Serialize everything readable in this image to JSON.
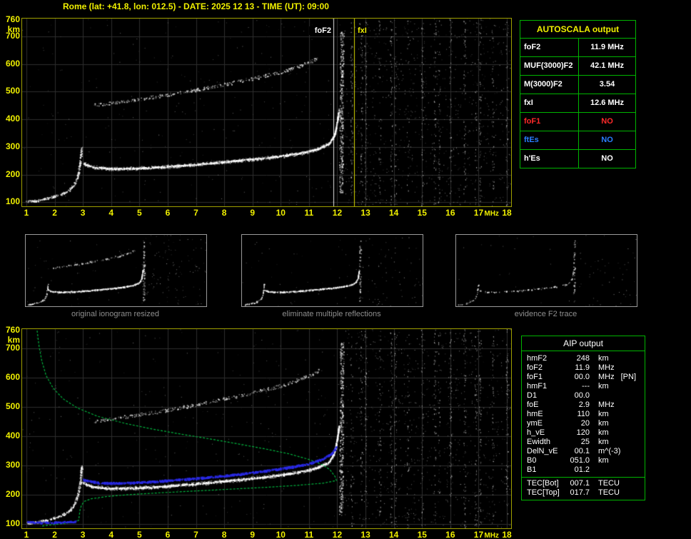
{
  "title": "Rome (lat: +41.8, lon: 012.5) - DATE: 2025 12 13 - TIME (UT): 09:00",
  "colors": {
    "accent": "#f0f000",
    "plot_border": "#a0a000",
    "table_border": "#00b400",
    "trace": "#ffffff",
    "profile": "#00b33c",
    "restored": "#2a2ae6",
    "caption": "#8f8f8f",
    "no_red": "#ff2a2a",
    "no_blue": "#2a7fff",
    "grid": "#2d2d2d"
  },
  "autoscala": {
    "header": "AUTOSCALA output",
    "rows": [
      {
        "label": "foF2",
        "value": "11.9 MHz",
        "color": "#ffffff"
      },
      {
        "label": "MUF(3000)F2",
        "value": "42.1 MHz",
        "color": "#ffffff"
      },
      {
        "label": "M(3000)F2",
        "value": "3.54",
        "color": "#ffffff"
      },
      {
        "label": "fxI",
        "value": "12.6 MHz",
        "color": "#ffffff"
      },
      {
        "label": "foF1",
        "value": "NO",
        "color": "#ff2a2a"
      },
      {
        "label": "ftEs",
        "value": "NO",
        "color": "#2a7fff"
      },
      {
        "label": "h'Es",
        "value": "NO",
        "color": "#ffffff"
      }
    ]
  },
  "thumbnails": [
    {
      "caption": "original ionogram resized"
    },
    {
      "caption": "eliminate multiple reflections"
    },
    {
      "caption": "evidence F2 trace"
    }
  ],
  "aip": {
    "header": "AIP output",
    "rows": [
      {
        "name": "hmF2",
        "value": "248",
        "unit": "km",
        "extra": ""
      },
      {
        "name": "foF2",
        "value": "11.9",
        "unit": "MHz",
        "extra": ""
      },
      {
        "name": "foF1",
        "value": "00.0",
        "unit": "MHz",
        "extra": "[PN]"
      },
      {
        "name": "hmF1",
        "value": "---",
        "unit": "km",
        "extra": ""
      },
      {
        "name": "D1",
        "value": "00.0",
        "unit": "",
        "extra": ""
      },
      {
        "name": "foE",
        "value": "2.9",
        "unit": "MHz",
        "extra": ""
      },
      {
        "name": "hmE",
        "value": "110",
        "unit": "km",
        "extra": ""
      },
      {
        "name": "ymE",
        "value": "20",
        "unit": "km",
        "extra": ""
      },
      {
        "name": "h_vE",
        "value": "120",
        "unit": "km",
        "extra": ""
      },
      {
        "name": "Ewidth",
        "value": "25",
        "unit": "km",
        "extra": ""
      },
      {
        "name": "DelN_vE",
        "value": "00.1",
        "unit": "m^(-3)",
        "extra": ""
      },
      {
        "name": "B0",
        "value": "051.0",
        "unit": "km",
        "extra": ""
      },
      {
        "name": "B1",
        "value": "01.2",
        "unit": "",
        "extra": ""
      }
    ],
    "tec_rows": [
      {
        "name": "TEC[Bot]",
        "value": "007.1",
        "unit": "TECU"
      },
      {
        "name": "TEC[Top]",
        "value": "017.7",
        "unit": "TECU"
      }
    ]
  },
  "chart_data": {
    "type": "scatter",
    "x_axis": {
      "label": "MHz",
      "range": [
        0.85,
        18.15
      ],
      "ticks": [
        1,
        2,
        3,
        4,
        5,
        6,
        7,
        8,
        9,
        10,
        11,
        12,
        13,
        14,
        15,
        16,
        17,
        18
      ]
    },
    "y_axis": {
      "unit": "km",
      "range": [
        85,
        765
      ],
      "ticks": [
        100,
        200,
        300,
        400,
        500,
        600,
        700,
        760
      ]
    },
    "markers": [
      {
        "name": "foF2",
        "f": 11.85,
        "color": "#ffffff"
      },
      {
        "name": "fxI",
        "f": 12.6,
        "color": "#f0f000"
      }
    ],
    "traces": {
      "e_region_tail": [
        [
          1.0,
          103
        ],
        [
          1.4,
          108
        ],
        [
          1.8,
          116
        ],
        [
          2.2,
          128
        ],
        [
          2.5,
          145
        ],
        [
          2.7,
          168
        ],
        [
          2.82,
          200
        ],
        [
          2.9,
          245
        ],
        [
          2.95,
          300
        ]
      ],
      "f2_first_hop": [
        [
          3.0,
          242
        ],
        [
          3.3,
          228
        ],
        [
          4,
          222
        ],
        [
          5,
          224
        ],
        [
          6,
          230
        ],
        [
          7,
          238
        ],
        [
          8,
          247
        ],
        [
          9,
          257
        ],
        [
          10,
          268
        ],
        [
          10.8,
          281
        ],
        [
          11.3,
          294
        ],
        [
          11.7,
          312
        ],
        [
          11.9,
          345
        ],
        [
          12.0,
          400
        ],
        [
          12.05,
          435
        ]
      ],
      "f2_second_hop": [
        [
          3.4,
          452
        ],
        [
          4,
          460
        ],
        [
          5,
          474
        ],
        [
          6,
          490
        ],
        [
          7,
          508
        ],
        [
          8,
          528
        ],
        [
          9,
          549
        ],
        [
          10,
          572
        ],
        [
          10.6,
          592
        ],
        [
          11.1,
          612
        ],
        [
          11.35,
          625
        ]
      ],
      "spread_f_column": [
        [
          12.12,
          130
        ],
        [
          12.16,
          720
        ]
      ],
      "profile_topside": [
        [
          1.38,
          760
        ],
        [
          1.45,
          706
        ],
        [
          1.55,
          655
        ],
        [
          1.7,
          606
        ],
        [
          1.95,
          563
        ],
        [
          2.3,
          527
        ],
        [
          2.8,
          496
        ],
        [
          3.5,
          468
        ],
        [
          4.5,
          443
        ],
        [
          5.5,
          423
        ],
        [
          6.5,
          406
        ],
        [
          7.5,
          390
        ],
        [
          8.5,
          373
        ],
        [
          9.5,
          355
        ],
        [
          10.3,
          339
        ],
        [
          11.0,
          320
        ],
        [
          11.5,
          301
        ],
        [
          11.75,
          284
        ],
        [
          11.92,
          262
        ],
        [
          11.97,
          248
        ]
      ],
      "profile_bottomside": [
        [
          11.97,
          248
        ],
        [
          11.5,
          239
        ],
        [
          10.5,
          231
        ],
        [
          9.5,
          225
        ],
        [
          8.5,
          220
        ],
        [
          7.5,
          215
        ],
        [
          6.5,
          210
        ],
        [
          5.5,
          205
        ],
        [
          4.5,
          199
        ],
        [
          3.8,
          193
        ],
        [
          3.3,
          186
        ],
        [
          3.05,
          177
        ],
        [
          2.95,
          164
        ],
        [
          2.9,
          148
        ],
        [
          2.87,
          128
        ],
        [
          2.85,
          112
        ],
        [
          2.7,
          106
        ],
        [
          2.3,
          101
        ],
        [
          1.8,
          96
        ],
        [
          1.5,
          92
        ]
      ],
      "restored_trace": [
        [
          3.0,
          252
        ],
        [
          3.6,
          241
        ],
        [
          4.5,
          241
        ],
        [
          5.5,
          246
        ],
        [
          6.5,
          253
        ],
        [
          7.5,
          261
        ],
        [
          8.5,
          271
        ],
        [
          9.5,
          283
        ],
        [
          10.4,
          296
        ],
        [
          11.0,
          308
        ],
        [
          11.5,
          324
        ],
        [
          11.8,
          343
        ],
        [
          11.95,
          365
        ]
      ],
      "restored_e_trace": [
        [
          1.0,
          108
        ],
        [
          1.6,
          106
        ],
        [
          2.2,
          107
        ],
        [
          2.8,
          110
        ]
      ]
    },
    "noise_columns_mhz": [
      12.5,
      12.85,
      13.0,
      13.5,
      13.9,
      14.05,
      14.5,
      15.0,
      15.45,
      15.6,
      16.0,
      16.5,
      16.9,
      17.05,
      17.5,
      18.0
    ]
  }
}
